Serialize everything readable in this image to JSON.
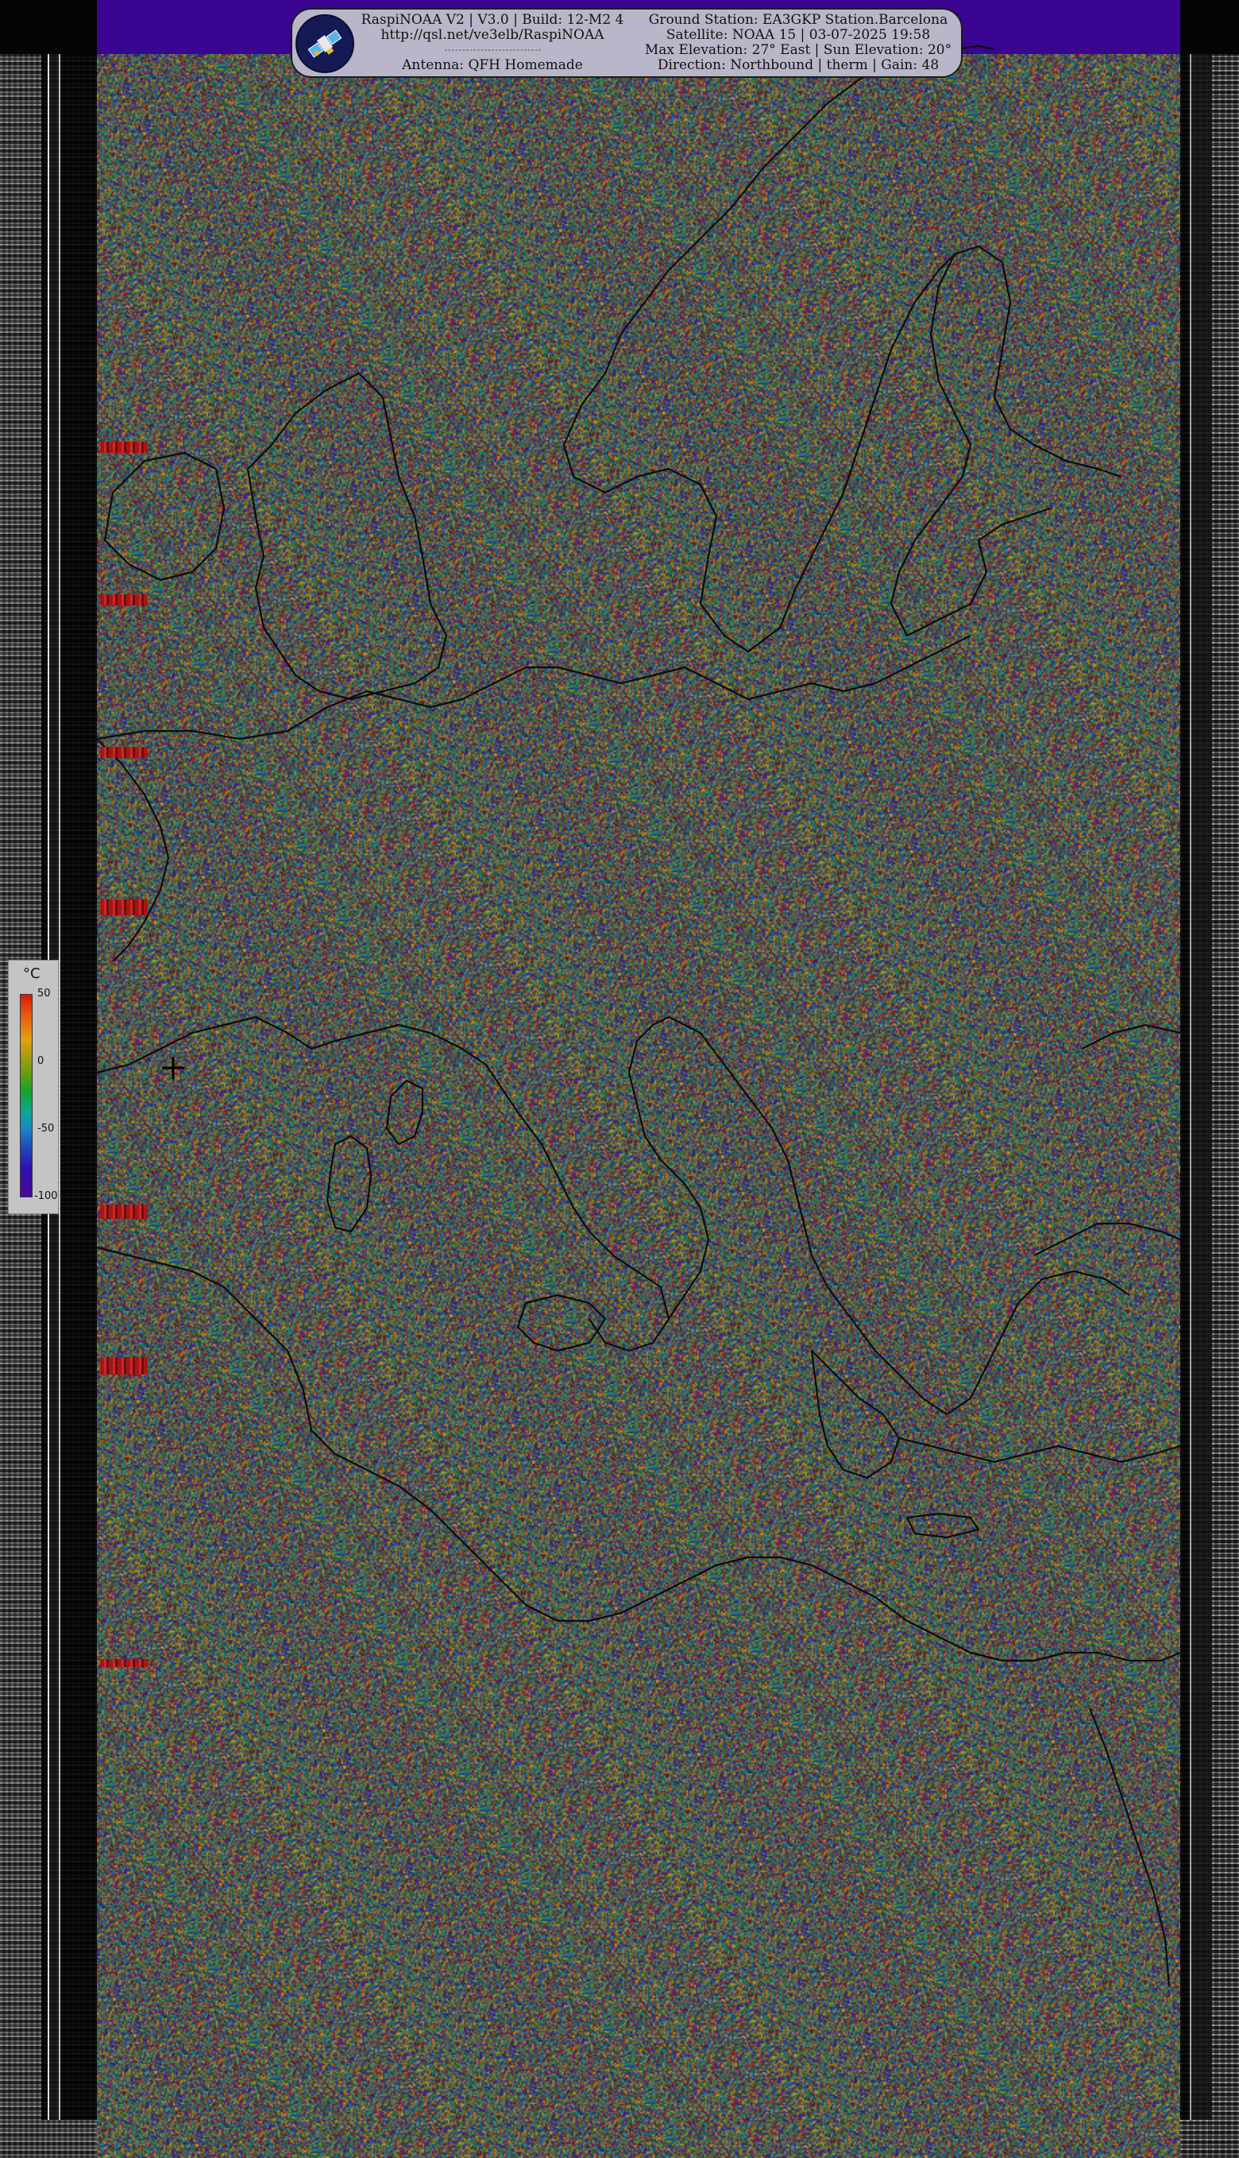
{
  "header": {
    "left_lines": [
      "RaspiNOAA V2 | V3.0 | Build: 12-M2 4",
      "http://qsl.net/ve3elb/RaspiNOAA",
      "Antenna: QFH Homemade"
    ],
    "right_lines": [
      "Ground Station: EA3GKP Station.Barcelona",
      "Satellite: NOAA 15 | 03-07-2025 19:58",
      "Max Elevation: 27° East | Sun Elevation: 20°",
      "Direction: Northbound | therm | Gain: 48"
    ],
    "logo_icon": "satellite-icon"
  },
  "legend": {
    "unit": "°C",
    "ticks": [
      {
        "label": "50",
        "value": 50
      },
      {
        "label": "0",
        "value": 0
      },
      {
        "label": "-50",
        "value": -50
      },
      {
        "label": "-100",
        "value": -100
      }
    ],
    "colors": [
      "#d71a08",
      "#e0a010",
      "#16a22c",
      "#0ca696",
      "#2046b8",
      "#4a0898"
    ]
  },
  "map": {
    "header_bar_color": "#3a0590",
    "crosshair_icon": "crosshair-icon"
  }
}
